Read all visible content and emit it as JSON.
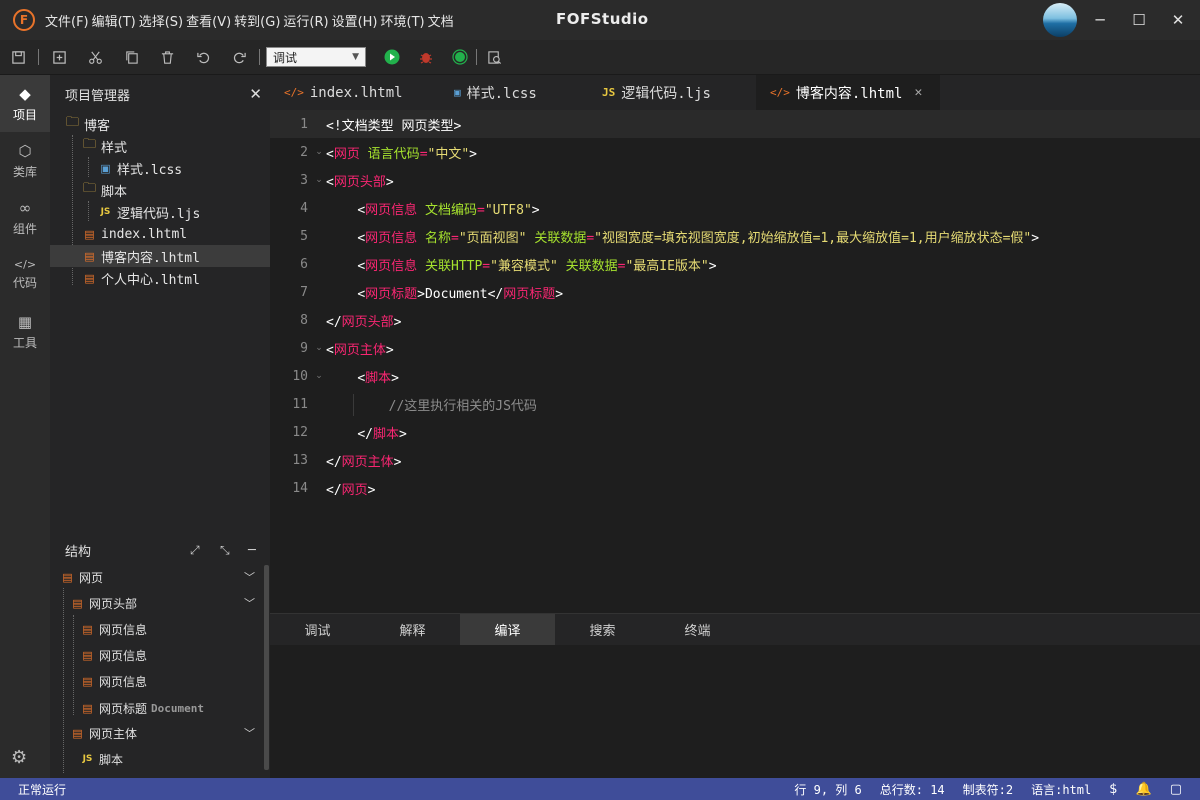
{
  "app": {
    "logo": "F",
    "title": "FOFStudio",
    "menu": [
      "文件(F)",
      "编辑(T)",
      "选择(S)",
      "查看(V)",
      "转到(G)",
      "运行(R)",
      "设置(H)",
      "环境(T)",
      "文档"
    ]
  },
  "window_controls": {
    "minimize": "─",
    "maximize": "☐",
    "close": "✕"
  },
  "toolbar": {
    "mode_value": "调试",
    "icons": [
      "save-icon",
      "new-file-icon",
      "cut-icon",
      "copy-icon",
      "delete-icon",
      "undo-icon",
      "redo-icon"
    ]
  },
  "activity": {
    "items": [
      {
        "icon": "◆",
        "label": "项目"
      },
      {
        "icon": "⬡",
        "label": "类库"
      },
      {
        "icon": "∞",
        "label": "组件"
      },
      {
        "icon": "</>",
        "label": "代码"
      },
      {
        "icon": "▦",
        "label": "工具"
      }
    ],
    "settings_icon": "⚙"
  },
  "project": {
    "title": "项目管理器",
    "close": "✕",
    "tree": [
      {
        "label": "博客",
        "type": "folder"
      },
      {
        "label": "样式",
        "type": "folder"
      },
      {
        "label": "样式.lcss",
        "type": "css"
      },
      {
        "label": "脚本",
        "type": "folder"
      },
      {
        "label": "逻辑代码.ljs",
        "type": "js"
      },
      {
        "label": "index.lhtml",
        "type": "html"
      },
      {
        "label": "博客内容.lhtml",
        "type": "html"
      },
      {
        "label": "个人中心.lhtml",
        "type": "html"
      }
    ]
  },
  "structure": {
    "title": "结构",
    "items": [
      {
        "label": "网页",
        "extra": ""
      },
      {
        "label": "网页头部",
        "extra": ""
      },
      {
        "label": "网页信息",
        "extra": ""
      },
      {
        "label": "网页信息",
        "extra": ""
      },
      {
        "label": "网页信息",
        "extra": ""
      },
      {
        "label": "网页标题",
        "extra": "Document"
      },
      {
        "label": "网页主体",
        "extra": ""
      },
      {
        "label": "脚本",
        "extra": ""
      }
    ]
  },
  "tabs": [
    {
      "label": "index.lhtml",
      "icon": "</>"
    },
    {
      "label": "样式.lcss",
      "icon": "▣"
    },
    {
      "label": "逻辑代码.ljs",
      "icon": "JS"
    },
    {
      "label": "博客内容.lhtml",
      "icon": "</>",
      "close": "✕"
    }
  ],
  "code_lines": [
    {
      "n": "1",
      "fold": "",
      "text": "<!文档类型 网页类型>"
    },
    {
      "n": "2",
      "fold": "⌄",
      "text": "<网页 语言代码=\"中文\">"
    },
    {
      "n": "3",
      "fold": "⌄",
      "text": "<网页头部>"
    },
    {
      "n": "4",
      "fold": "",
      "text": "    <网页信息 文档编码=\"UTF8\">"
    },
    {
      "n": "5",
      "fold": "",
      "text": "    <网页信息 名称=\"页面视图\" 关联数据=\"视图宽度=填充视图宽度,初始缩放值=1,最大缩放值=1,用户缩放状态=假\">"
    },
    {
      "n": "6",
      "fold": "",
      "text": "    <网页信息 关联HTTP=\"兼容模式\" 关联数据=\"最高IE版本\">"
    },
    {
      "n": "7",
      "fold": "",
      "text": "    <网页标题>Document</网页标题>"
    },
    {
      "n": "8",
      "fold": "",
      "text": "</网页头部>"
    },
    {
      "n": "9",
      "fold": "⌄",
      "text": "<网页主体>"
    },
    {
      "n": "10",
      "fold": "⌄",
      "text": "    <脚本>"
    },
    {
      "n": "11",
      "fold": "",
      "text": "        //这里执行相关的JS代码"
    },
    {
      "n": "12",
      "fold": "",
      "text": "    </脚本>"
    },
    {
      "n": "13",
      "fold": "",
      "text": "</网页主体>"
    },
    {
      "n": "14",
      "fold": "",
      "text": "</网页>"
    }
  ],
  "panel_tabs": [
    "调试",
    "解释",
    "编译",
    "搜索",
    "终端"
  ],
  "status": {
    "left": "正常运行",
    "position": "行 9, 列 6",
    "total_lines": "总行数: 14",
    "tab_size": "制表符:2",
    "language": "语言:html",
    "icons": [
      "$",
      "🔔",
      "▢"
    ]
  },
  "colors": {
    "status_bar": "#3f4d99",
    "tag": "#f92672",
    "attribute": "#a6e22e",
    "string": "#e6db74"
  }
}
